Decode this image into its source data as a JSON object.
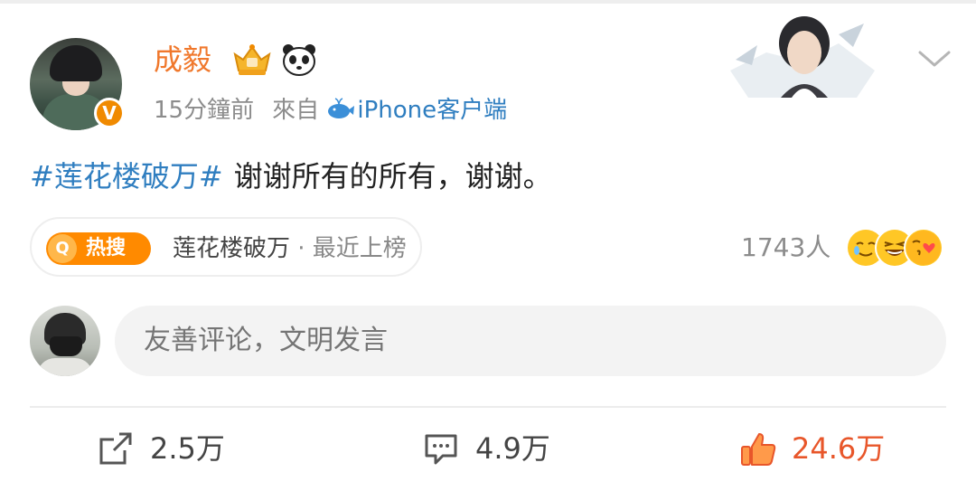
{
  "post": {
    "author": {
      "name": "成毅",
      "verified_badge": "V",
      "colors": {
        "name": "#f0782c",
        "badge": "#f08a00"
      }
    },
    "meta": {
      "time": "15分鐘前",
      "source_prefix": "來自",
      "device": "iPhone客户端"
    },
    "content": {
      "hashtag": "#莲花楼破万#",
      "text": "谢谢所有的所有，谢谢。"
    },
    "hot_search": {
      "badge": "热搜",
      "badge_icon": "Q",
      "topic": "莲花楼破万",
      "status": " · 最近上榜"
    },
    "reactions": {
      "count": "1743人",
      "emojis": [
        "tears-of-joy-emoji",
        "laughing-emoji",
        "kiss-heart-emoji"
      ]
    },
    "comment_box": {
      "placeholder": "友善评论，文明发言"
    },
    "actions": {
      "share_count": "2.5万",
      "comment_count": "4.9万",
      "like_count": "24.6万"
    }
  },
  "theme": {
    "link_blue": "#2f7ec0",
    "like_orange": "#e8562a",
    "hot_orange": "#ff8a00",
    "muted": "#8c8c8c"
  }
}
